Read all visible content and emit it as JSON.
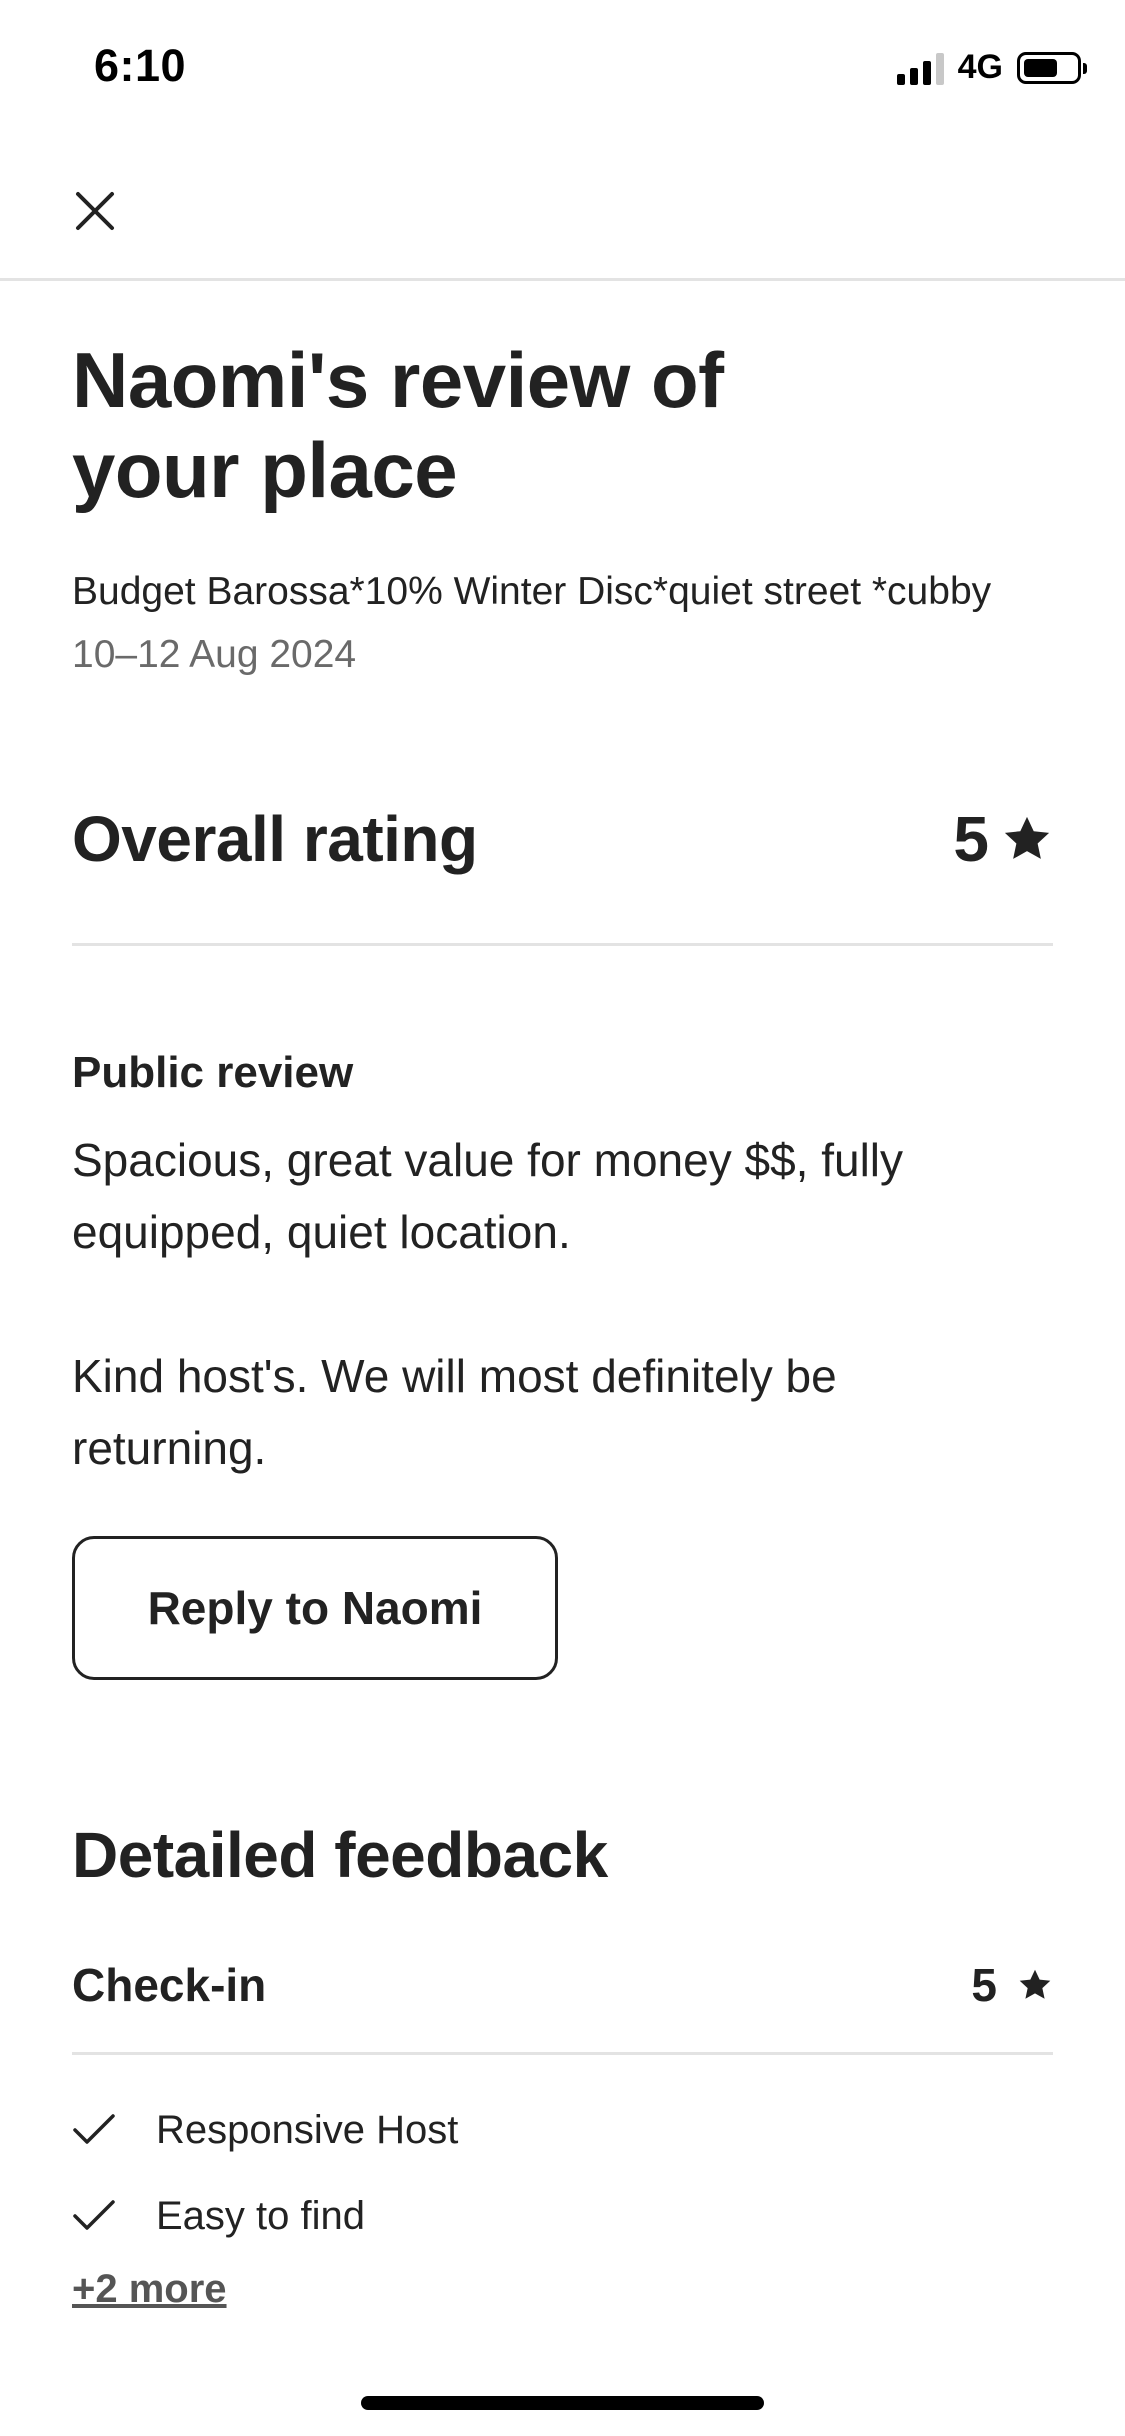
{
  "status_bar": {
    "time": "6:10",
    "network": "4G",
    "battery_level": 0.7
  },
  "nav": {
    "close_icon": "close-icon"
  },
  "page": {
    "title": "Naomi's review of your place",
    "listing_name": "Budget Barossa*10% Winter Disc*quiet street *cubby",
    "dates": "10–12 Aug 2024"
  },
  "overall": {
    "label": "Overall rating",
    "score": "5",
    "icon": "star-icon"
  },
  "public_review": {
    "label": "Public review",
    "paragraphs": [
      "Spacious, great value for money $$, fully equipped, quiet location.",
      "Kind host's. We will most definitely be returning."
    ]
  },
  "reply_button": {
    "label": "Reply to Naomi"
  },
  "detailed": {
    "title": "Detailed feedback",
    "categories": [
      {
        "label": "Check-in",
        "score": "5",
        "items": [
          "Responsive Host",
          "Easy to find"
        ],
        "more_link": "+2 more"
      }
    ]
  },
  "colors": {
    "text": "#222222",
    "muted": "#6a6a6a",
    "divider": "#e3e3e3",
    "background": "#ffffff"
  }
}
